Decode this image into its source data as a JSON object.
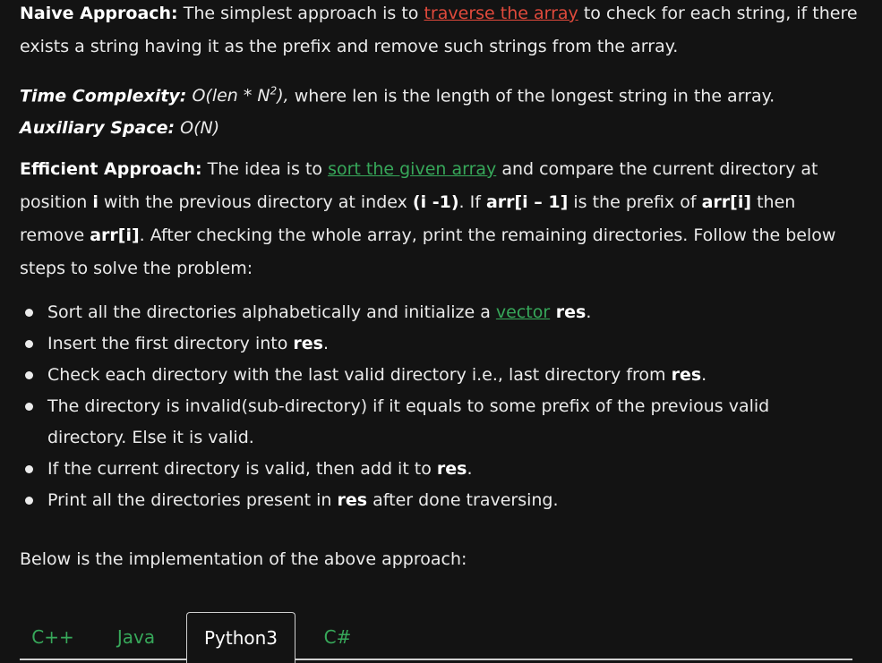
{
  "naive": {
    "title": "Naive Approach:",
    "text1": " The simplest approach is to ",
    "link": "traverse the array",
    "text2": " to check for each string, if there exists a string having it as the prefix and remove such strings from the array."
  },
  "complexity": {
    "time_label": "Time Complexity:",
    "time_value_pre": " O(len * N",
    "time_value_sup": "2",
    "time_value_post": "),",
    "time_desc": " where len is the length of the longest string in the array.",
    "space_label": "Auxiliary Space:",
    "space_value": " O(N)"
  },
  "efficient": {
    "title": "Efficient Approach:",
    "t1": " The idea is to ",
    "link": "sort the given array",
    "t2": " and compare the current directory at position ",
    "b1": "i",
    "t3": " with the previous directory at index ",
    "b2": "(i -1)",
    "t4": ". If ",
    "b3": "arr[i – 1]",
    "t5": " is the prefix of ",
    "b4": "arr[i]",
    "t6": " then remove ",
    "b5": "arr[i]",
    "t7": ". After checking the whole array, print the remaining directories. Follow the below steps to solve the problem:"
  },
  "steps": {
    "s1_pre": "Sort all the directories alphabetically and initialize a ",
    "s1_link": "vector",
    "s1_bold": " res",
    "s1_post": ".",
    "s2_pre": "Insert the first directory into ",
    "s2_bold": "res",
    "s2_post": ".",
    "s3_pre": "Check each directory with the last valid directory i.e., last directory from ",
    "s3_bold": "res",
    "s3_post": ".",
    "s4": "The directory is invalid(sub-directory) if it equals to some prefix of the previous valid directory. Else it is valid.",
    "s5_pre": "If the current directory is valid, then add it to ",
    "s5_bold": "res",
    "s5_post": ".",
    "s6_pre": "Print all the directories present in ",
    "s6_bold": "res",
    "s6_post": " after done traversing."
  },
  "implementation_text": "Below is the implementation of the above approach:",
  "tabs": [
    "C++",
    "Java",
    "Python3",
    "C#"
  ],
  "active_tab": "Python3"
}
